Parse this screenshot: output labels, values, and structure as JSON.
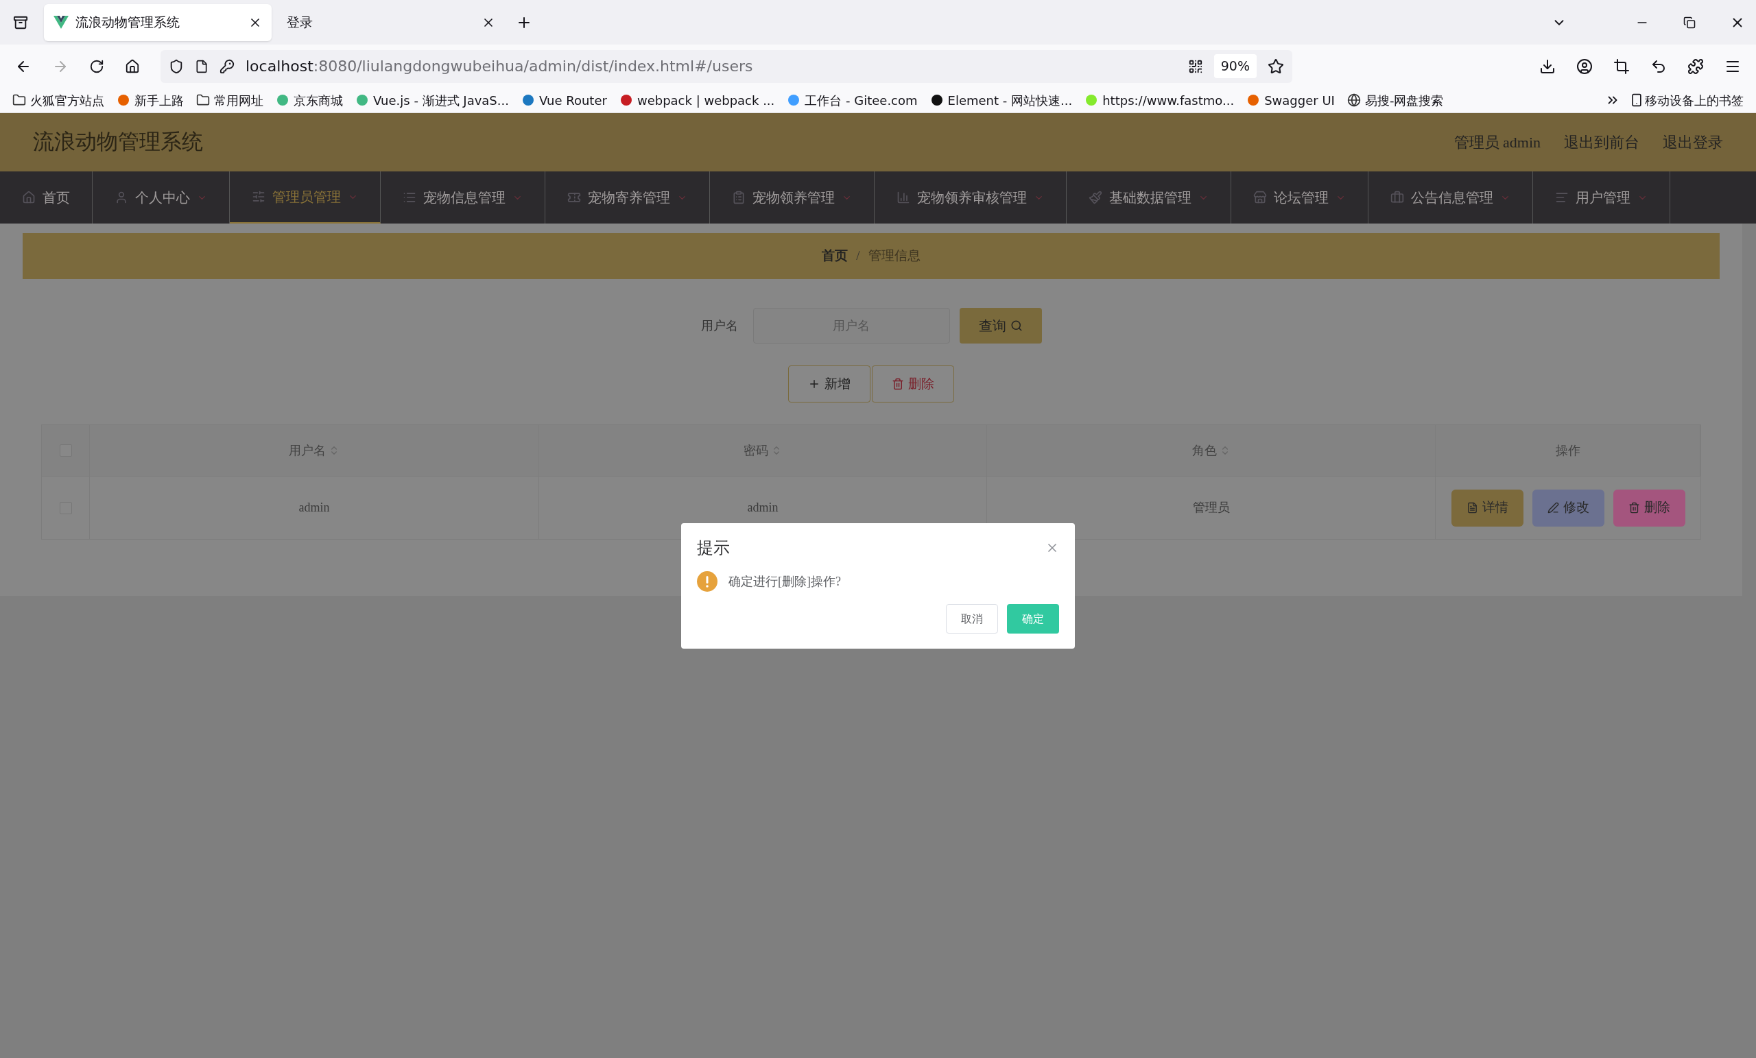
{
  "browser": {
    "tabs": [
      {
        "title": "流浪动物管理系统",
        "selected": true
      },
      {
        "title": "登录",
        "selected": false
      }
    ],
    "url": {
      "host": "localhost",
      "path": ":8080/liulangdongwubeihua/admin/dist/index.html#/users"
    },
    "zoom": "90%",
    "bookmarks": [
      {
        "label": "火狐官方站点",
        "kind": "folder"
      },
      {
        "label": "新手上路",
        "kind": "site"
      },
      {
        "label": "常用网址",
        "kind": "folder"
      },
      {
        "label": "京东商城",
        "kind": "site"
      },
      {
        "label": "Vue.js - 渐进式 JavaS...",
        "kind": "site"
      },
      {
        "label": "Vue Router",
        "kind": "site"
      },
      {
        "label": "webpack | webpack ...",
        "kind": "site"
      },
      {
        "label": "工作台 - Gitee.com",
        "kind": "site"
      },
      {
        "label": "Element - 网站快速...",
        "kind": "site"
      },
      {
        "label": "https://www.fastmo...",
        "kind": "site"
      },
      {
        "label": "Swagger UI",
        "kind": "site"
      },
      {
        "label": "易搜-网盘搜索",
        "kind": "globe"
      }
    ],
    "mobile_bookmarks": "移动设备上的书签"
  },
  "app": {
    "title": "流浪动物管理系统",
    "user_links": [
      "管理员 admin",
      "退出到前台",
      "退出登录"
    ],
    "nav": [
      {
        "label": "首页",
        "selected": false,
        "has_menu": false
      },
      {
        "label": "个人中心",
        "selected": false,
        "has_menu": true
      },
      {
        "label": "管理员管理",
        "selected": true,
        "has_menu": true
      },
      {
        "label": "宠物信息管理",
        "selected": false,
        "has_menu": true
      },
      {
        "label": "宠物寄养管理",
        "selected": false,
        "has_menu": true
      },
      {
        "label": "宠物领养管理",
        "selected": false,
        "has_menu": true
      },
      {
        "label": "宠物领养审核管理",
        "selected": false,
        "has_menu": true
      },
      {
        "label": "基础数据管理",
        "selected": false,
        "has_menu": true
      },
      {
        "label": "论坛管理",
        "selected": false,
        "has_menu": true
      },
      {
        "label": "公告信息管理",
        "selected": false,
        "has_menu": true
      },
      {
        "label": "用户管理",
        "selected": false,
        "has_menu": true
      }
    ],
    "breadcrumb": [
      "首页",
      "管理信息"
    ],
    "breadcrumb_separator": "/",
    "search": {
      "label": "用户名",
      "placeholder": "用户名",
      "button": "查询"
    },
    "actions": [
      {
        "label": "新增",
        "kind": "add"
      },
      {
        "label": "删除",
        "kind": "delete"
      }
    ],
    "table": {
      "columns": [
        {
          "label": "用户名",
          "sortable": true
        },
        {
          "label": "密码",
          "sortable": true
        },
        {
          "label": "角色",
          "sortable": true
        },
        {
          "label": "操作",
          "sortable": false
        }
      ],
      "all_checked": false,
      "rows": [
        {
          "checked": false,
          "cells": [
            "admin",
            "admin",
            "管理员"
          ],
          "buttons": [
            {
              "label": "详情",
              "kind": "detail"
            },
            {
              "label": "修改",
              "kind": "edit"
            },
            {
              "label": "删除",
              "kind": "delete"
            }
          ]
        }
      ]
    }
  },
  "dialog": {
    "title": "提示",
    "message": "确定进行[删除]操作?",
    "cancel": "取消",
    "confirm": "确定"
  }
}
